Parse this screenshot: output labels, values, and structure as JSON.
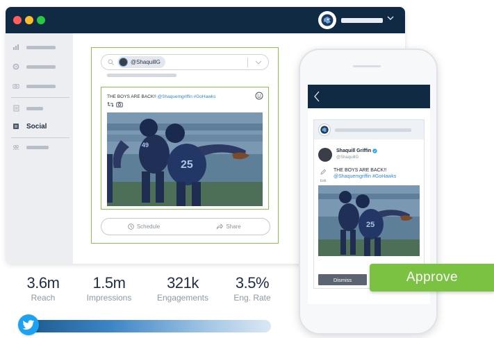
{
  "window": {
    "nav": {
      "social_label": "Social"
    }
  },
  "composer": {
    "account_handle": "@ShaquillG",
    "post_text": "THE BOYS ARE BACK!! ",
    "post_tags": "@Shaquemgriffin #GoHawks",
    "schedule_label": "Schedule",
    "share_label": "Share"
  },
  "stats": [
    {
      "value": "3.6m",
      "label": "Reach"
    },
    {
      "value": "1.5m",
      "label": "Impressions"
    },
    {
      "value": "321k",
      "label": "Engagements"
    },
    {
      "value": "3.5%",
      "label": "Eng. Rate"
    }
  ],
  "phone": {
    "user_name": "Shaquill Griffin",
    "user_handle": "@ShaquillG",
    "edit_label": "Edit",
    "post_text": "THE BOYS ARE BACK!!",
    "post_tags": "@Shaquemgriffin #GoHawks",
    "dismiss_label": "Dismiss"
  },
  "approve_label": "Approve",
  "colors": {
    "navy": "#112a44",
    "accent_green": "#7cc242",
    "border_green": "#8bc34a",
    "twitter_blue": "#1da1f2"
  },
  "icons": [
    "search-icon",
    "chevron-down-icon",
    "smile-icon",
    "retweet-icon",
    "camera-icon",
    "clock-icon",
    "share-icon",
    "back-icon",
    "edit-icon",
    "twitter-icon",
    "verified-icon"
  ]
}
